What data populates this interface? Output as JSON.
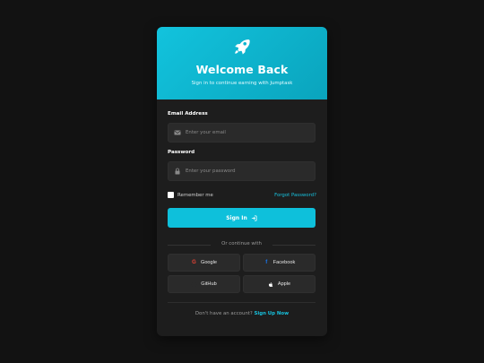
{
  "header": {
    "title": "Welcome Back",
    "subtitle": "Sign in to continue earning with Jumptask"
  },
  "form": {
    "email_label": "Email Address",
    "email_placeholder": "Enter your email",
    "email_value": "",
    "password_label": "Password",
    "password_placeholder": "Enter your password",
    "password_value": "",
    "remember_label": "Remember me",
    "remember_checked": false,
    "forgot_label": "Forgot Password?",
    "signin_label": "Sign In"
  },
  "divider": {
    "text": "Or continue with"
  },
  "social": {
    "google": "Google",
    "facebook": "Facebook",
    "github": "GitHub",
    "apple": "Apple"
  },
  "footer": {
    "prompt": "Don't have an account?",
    "signup_label": "Sign Up Now"
  },
  "colors": {
    "accent": "#0ec0db",
    "background": "#121212",
    "card": "#1d1d1d",
    "field": "#2a2a2a",
    "google": "#ea4335",
    "facebook": "#1877f2"
  },
  "icons": {
    "header": "rocket-icon",
    "email": "envelope-icon",
    "password": "lock-icon",
    "signin": "sign-in-icon",
    "google": "google-icon",
    "facebook": "facebook-icon",
    "github": "github-icon",
    "apple": "apple-icon"
  }
}
